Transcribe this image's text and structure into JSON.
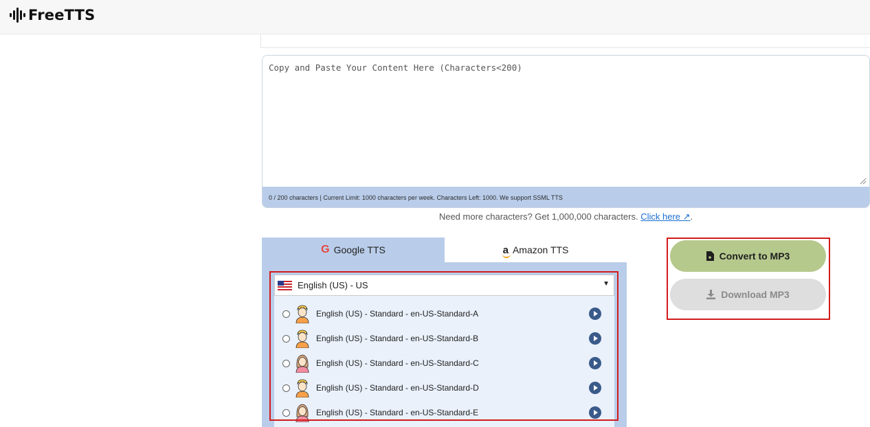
{
  "header": {
    "logo_text": "FreeTTS",
    "logo_icon": "sound-wave-icon"
  },
  "editor": {
    "placeholder": "Copy and Paste Your Content Here (Characters<200)",
    "value": "",
    "char_status": "0 / 200 characters | Current Limit: 1000 characters per week. Characters Left: 1000. We support SSML TTS"
  },
  "upsell": {
    "text": "Need more characters? Get 1,000,000 characters.",
    "link_text": "Click here ↗",
    "trailing": "."
  },
  "tts": {
    "tabs": [
      {
        "label": "Google TTS",
        "icon": "google-icon",
        "active": true
      },
      {
        "label": "Amazon TTS",
        "icon": "amazon-icon",
        "active": false
      }
    ],
    "language": {
      "selected": "English (US) - US",
      "flag_icon": "us-flag-icon"
    },
    "voices": [
      {
        "label": "English (US) - Standard - en-US-Standard-A",
        "gender": "male"
      },
      {
        "label": "English (US) - Standard - en-US-Standard-B",
        "gender": "male"
      },
      {
        "label": "English (US) - Standard - en-US-Standard-C",
        "gender": "female"
      },
      {
        "label": "English (US) - Standard - en-US-Standard-D",
        "gender": "male"
      },
      {
        "label": "English (US) - Standard - en-US-Standard-E",
        "gender": "female"
      }
    ]
  },
  "actions": {
    "convert_label": "Convert to MP3",
    "download_label": "Download MP3"
  },
  "colors": {
    "panel_blue": "#b9cdea",
    "convert_green": "#b6c98d",
    "download_gray": "#dedede",
    "highlight_red": "#d11a1a",
    "play_blue": "#3a5a8a"
  }
}
